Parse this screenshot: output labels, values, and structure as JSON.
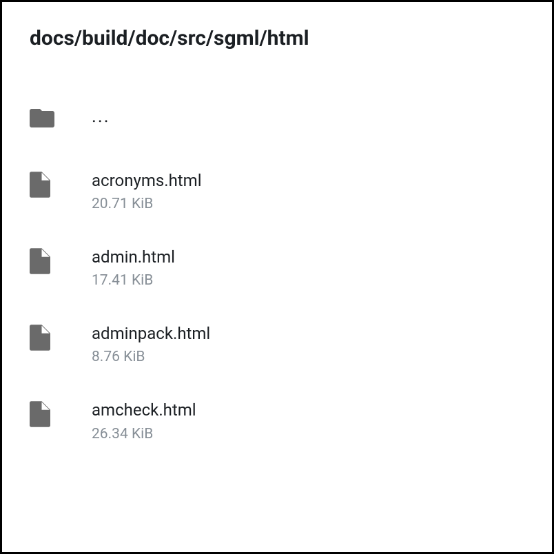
{
  "breadcrumb": "docs/build/doc/src/sgml/html",
  "parent_label": "...",
  "files": [
    {
      "name": "acronyms.html",
      "size": "20.71 KiB"
    },
    {
      "name": "admin.html",
      "size": "17.41 KiB"
    },
    {
      "name": "adminpack.html",
      "size": "8.76 KiB"
    },
    {
      "name": "amcheck.html",
      "size": "26.34 KiB"
    }
  ]
}
